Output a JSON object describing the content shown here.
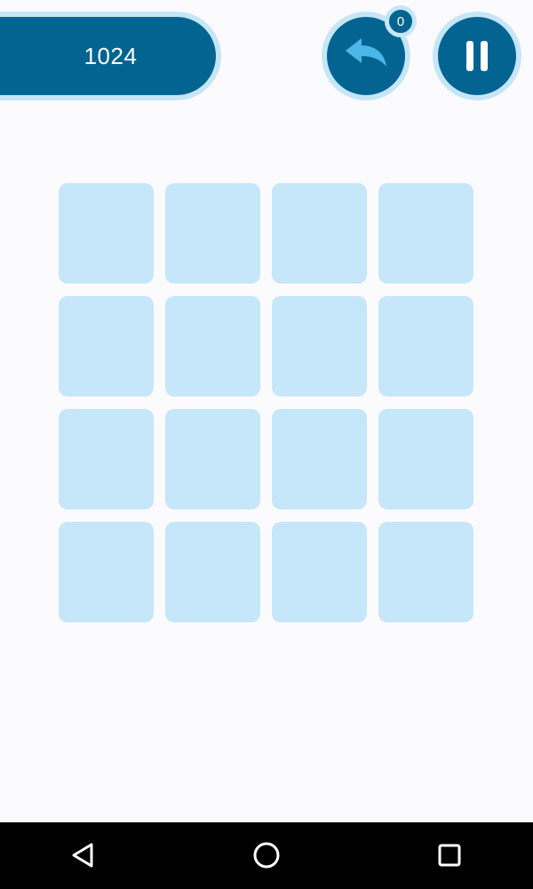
{
  "score": {
    "value": "1024"
  },
  "undo": {
    "icon": "undo-arrow-icon",
    "count": "0"
  },
  "pause": {
    "icon": "pause-icon"
  },
  "board": {
    "rows": 4,
    "columns": 4,
    "tiles": [
      [
        "",
        "",
        "",
        ""
      ],
      [
        "",
        "",
        "",
        ""
      ],
      [
        "",
        "",
        "",
        ""
      ],
      [
        "",
        "",
        "",
        ""
      ]
    ]
  },
  "colors": {
    "accent": "#036491",
    "outline": "#c6e6f8",
    "tile_empty": "#c6e6fa",
    "undo_arrow": "#4db6e8",
    "background": "#fbfbfd"
  },
  "navigation_bar": {
    "buttons": [
      "back-triangle-icon",
      "home-circle-icon",
      "recents-square-icon"
    ]
  }
}
